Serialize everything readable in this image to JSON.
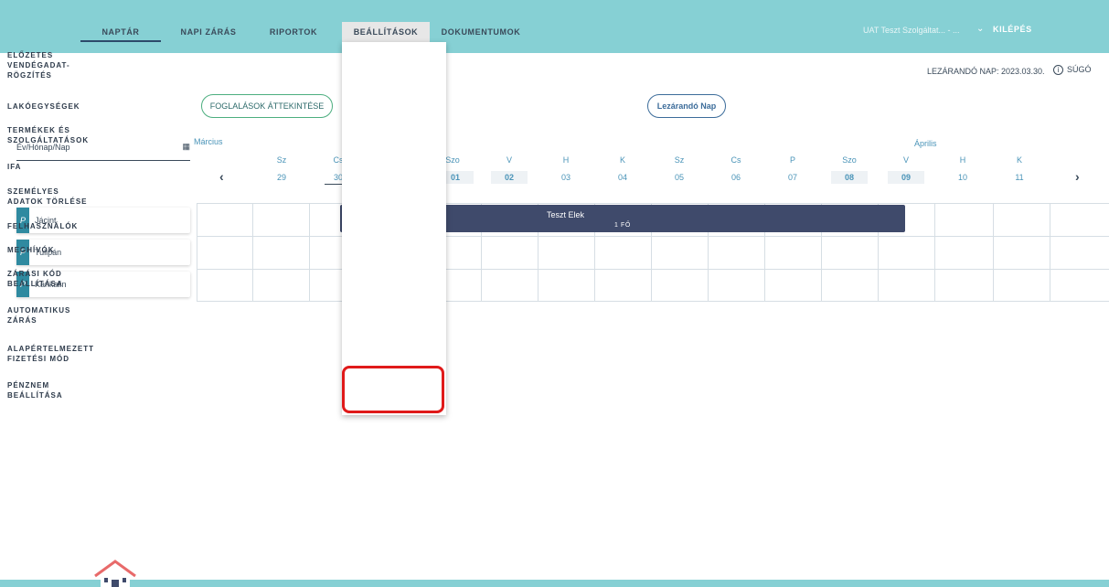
{
  "nav": {
    "items": [
      "NAPTÁR",
      "NAPI ZÁRÁS",
      "RIPORTOK",
      "BEÁLLÍTÁSOK",
      "DOKUMENTUMOK"
    ],
    "company": "UAT Teszt Szolgáltat... - ...",
    "logout": "KILÉPÉS"
  },
  "subheader": {
    "closing_day": "LEZÁRANDÓ NAP: 2023.03.30.",
    "help": "SÚGÓ"
  },
  "buttons": {
    "overview": "FOGLALÁSOK ÁTTEKINTÉSE",
    "closing_day": "Lezárandó Nap"
  },
  "date_field": {
    "placeholder": "Év/Hónap/Nap"
  },
  "calendar": {
    "months": [
      "Március",
      "Április"
    ],
    "days": [
      {
        "dow": "Sz",
        "num": "29"
      },
      {
        "dow": "Cs",
        "num": "30"
      },
      {
        "dow": "Szo",
        "num": "01"
      },
      {
        "dow": "V",
        "num": "02"
      },
      {
        "dow": "H",
        "num": "03"
      },
      {
        "dow": "K",
        "num": "04"
      },
      {
        "dow": "Sz",
        "num": "05"
      },
      {
        "dow": "Cs",
        "num": "06"
      },
      {
        "dow": "P",
        "num": "07"
      },
      {
        "dow": "Szo",
        "num": "08"
      },
      {
        "dow": "V",
        "num": "09"
      },
      {
        "dow": "H",
        "num": "10"
      },
      {
        "dow": "K",
        "num": "11"
      }
    ],
    "prev": "‹",
    "next": "›"
  },
  "rooms": [
    {
      "tag": "P",
      "name": "Jácint"
    },
    {
      "tag": "P",
      "name": "Tulipán"
    },
    {
      "tag": "P",
      "name": "Kankalin"
    }
  ],
  "booking": {
    "guest": "Teszt Elek",
    "people": "1 FŐ"
  },
  "dropdown": {
    "items": [
      [
        "ELŐZETES",
        "VENDÉGADAT-",
        "RÖGZÍTÉS"
      ],
      [
        "LAKÓEGYSÉGEK"
      ],
      [
        "TERMÉKEK ÉS",
        "SZOLGÁLTATÁSOK"
      ],
      [
        "IFA"
      ],
      [
        "SZEMÉLYES",
        "ADATOK TÖRLÉSE"
      ],
      [
        "FELHASZNÁLÓK"
      ],
      [
        "MEGHÍVÓK"
      ],
      [
        "ZÁRÁSI KÓD",
        "BEÁLLÍTÁSA"
      ],
      [
        "AUTOMATIKUS",
        "ZÁRÁS"
      ],
      [
        "ALAPÉRTELMEZETT",
        "FIZETÉSI MÓD"
      ],
      [
        "PÉNZNEM",
        "BEÁLLÍTÁSA"
      ]
    ]
  },
  "colors": {
    "topbar": "#86d0d4",
    "highlight": "#e01a1a",
    "booking": "#3f4a6b",
    "room_tag": "#2f8aa0"
  }
}
